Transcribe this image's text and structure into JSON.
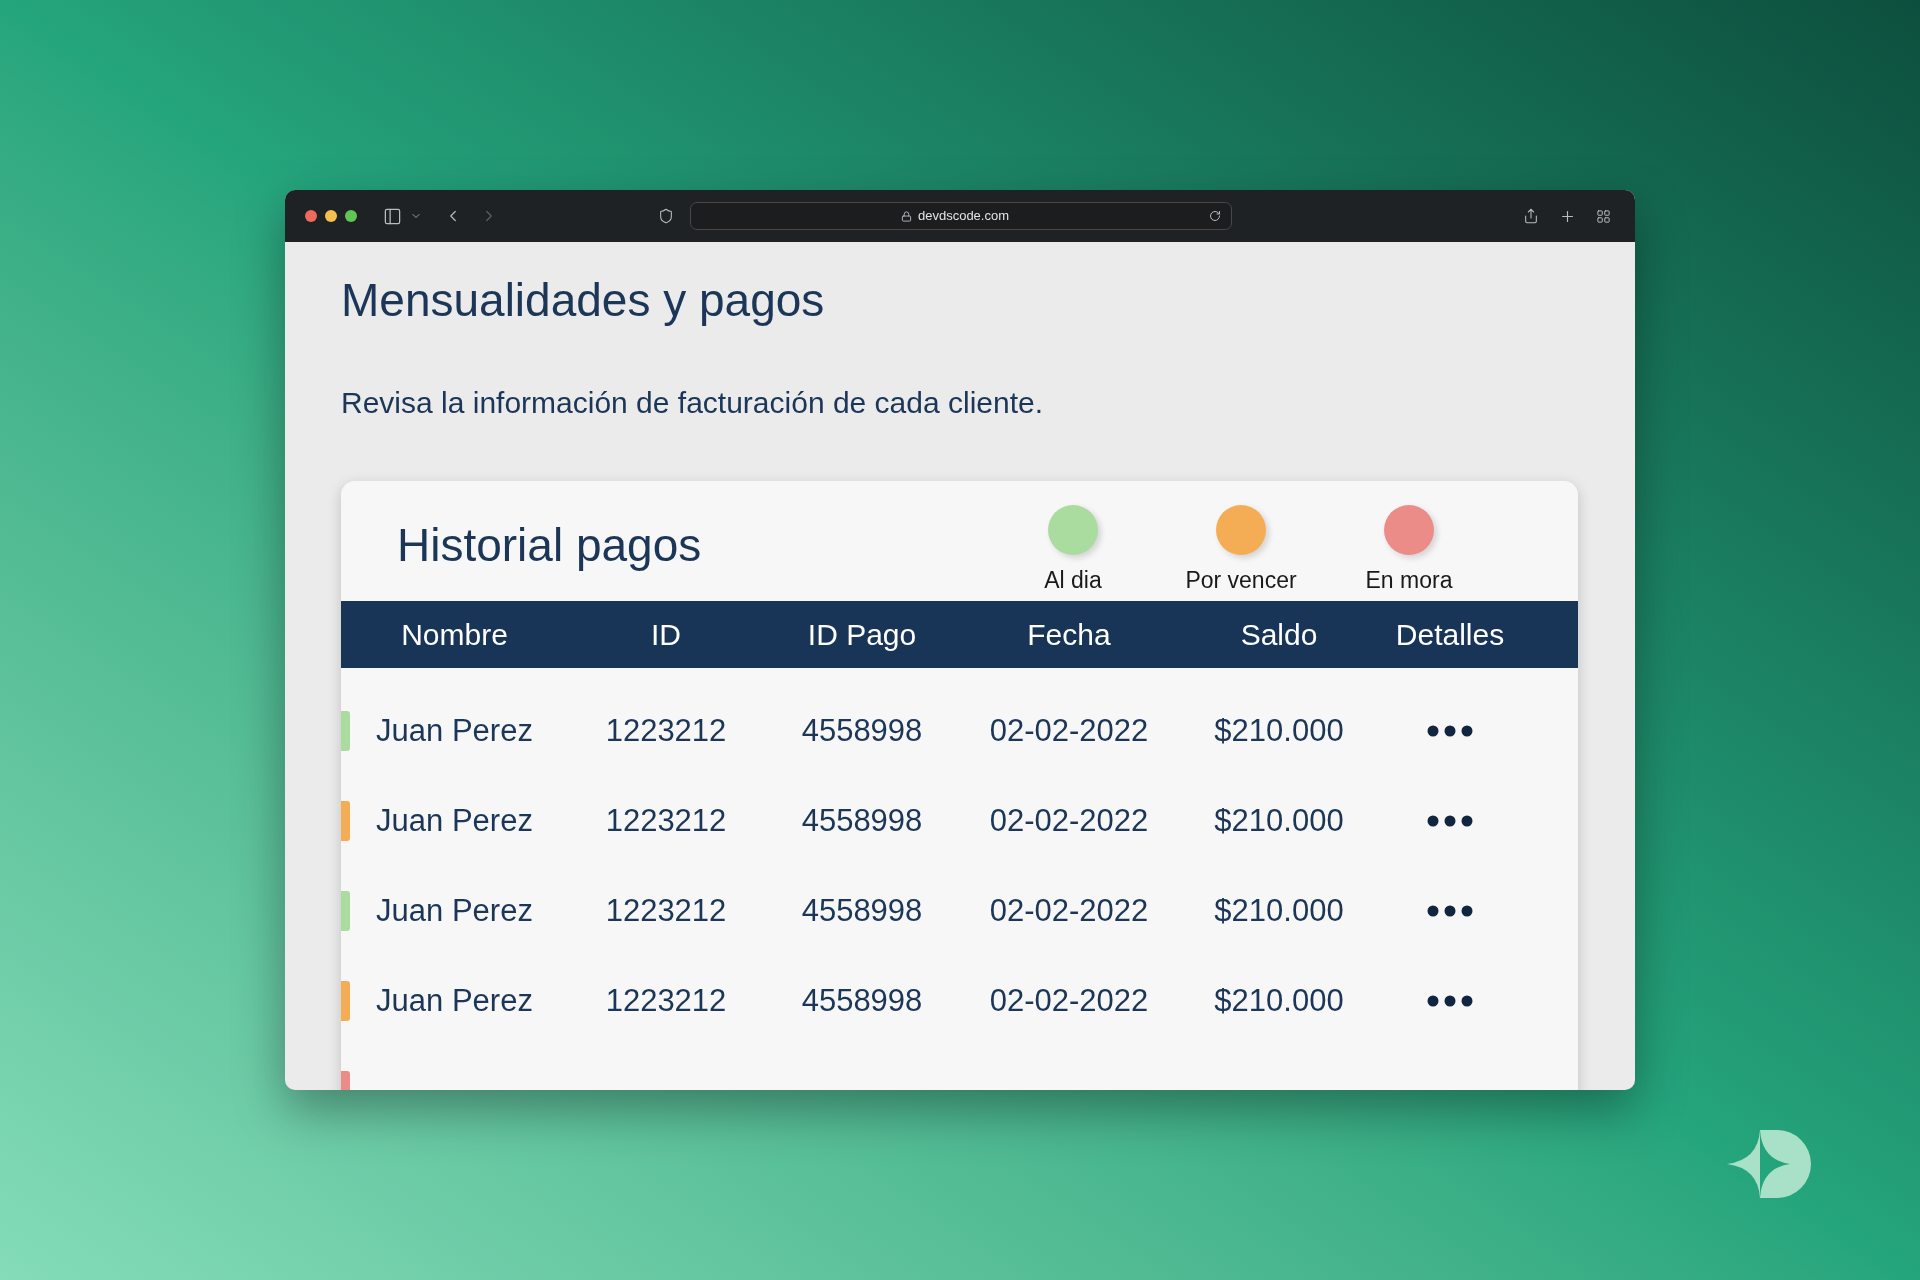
{
  "browser": {
    "url": "devdscode.com"
  },
  "page": {
    "title": "Mensualidades y pagos",
    "subtitle": "Revisa la información de facturación de cada cliente."
  },
  "card": {
    "title": "Historial pagos",
    "legend": [
      {
        "label": "Al dia",
        "color": "#a9dc9e"
      },
      {
        "label": "Por vencer",
        "color": "#f5ad55"
      },
      {
        "label": "En mora",
        "color": "#eb8c88"
      }
    ],
    "columns": [
      "Nombre",
      "ID",
      "ID Pago",
      "Fecha",
      "Saldo",
      "Detalles"
    ],
    "rows": [
      {
        "color": "#a9dc9e",
        "cells": [
          "Juan Perez",
          "1223212",
          "4558998",
          "02-02-2022",
          "$210.000"
        ]
      },
      {
        "color": "#f5ad55",
        "cells": [
          "Juan Perez",
          "1223212",
          "4558998",
          "02-02-2022",
          "$210.000"
        ]
      },
      {
        "color": "#a9dc9e",
        "cells": [
          "Juan Perez",
          "1223212",
          "4558998",
          "02-02-2022",
          "$210.000"
        ]
      },
      {
        "color": "#f5ad55",
        "cells": [
          "Juan Perez",
          "1223212",
          "4558998",
          "02-02-2022",
          "$210.000"
        ]
      },
      {
        "color": "#eb8c88"
      }
    ]
  }
}
